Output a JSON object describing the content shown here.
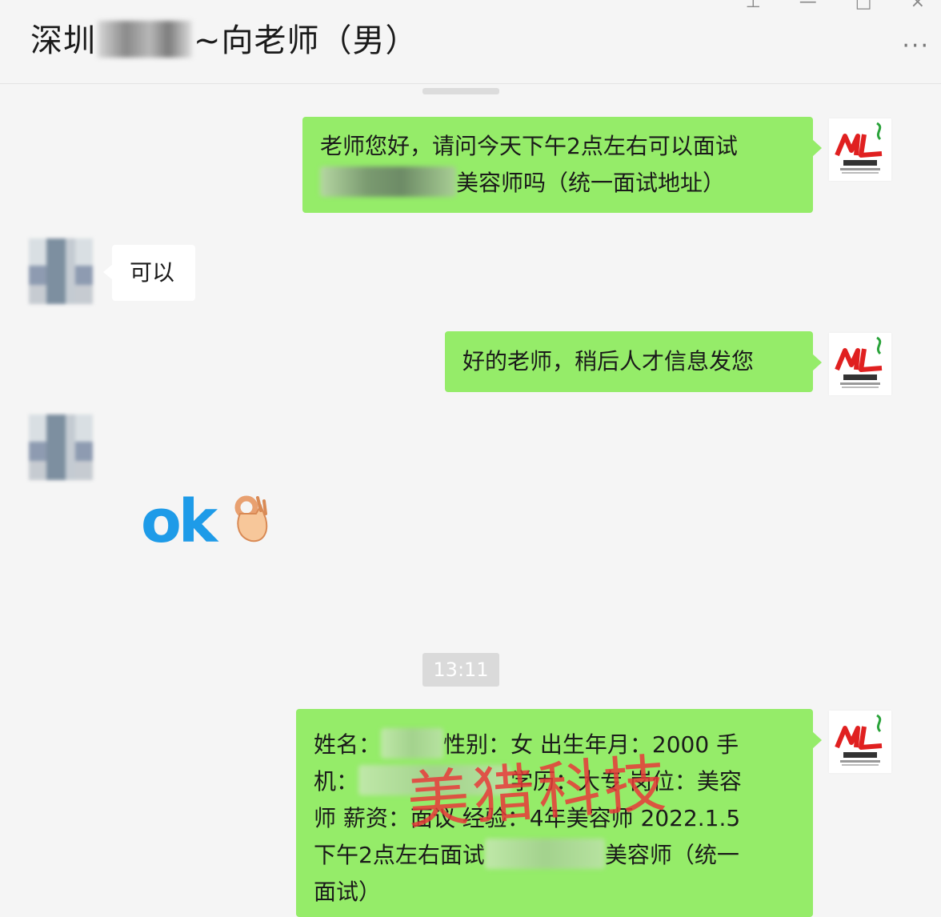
{
  "header": {
    "title_prefix": "深圳",
    "title_suffix": "~向老师（男）",
    "more_label": "···"
  },
  "messages": [
    {
      "from": "me",
      "line1": "老师您好，请问今天下午2点左右可以面试",
      "line2_after_blur": "美容师吗（统一面试地址）"
    },
    {
      "from": "other",
      "text": "可以"
    },
    {
      "from": "me",
      "text": "好的老师，稍后人才信息发您"
    },
    {
      "from": "other",
      "sticker": "ok",
      "sticker_text": "ok",
      "sticker_icon": "ok-hand-icon"
    },
    {
      "from": "me",
      "p1a": "姓名：",
      "p1b": "性别：女 出生年月：2000 手",
      "p2a": "机：",
      "p2b": "学历：大专 岗位：美容",
      "p3": "师 薪资：面议 经验：4年美容师 2022.1.5",
      "p4a": "下午2点左右面试",
      "p4b": "美容师（统一",
      "p5": "面试）"
    }
  ],
  "timestamp": "13:11",
  "watermark": "美猎科技",
  "colors": {
    "my_bubble": "#95ec69",
    "other_bubble": "#ffffff",
    "background": "#f5f5f5",
    "ok_blue": "#1e9be8",
    "logo_red": "#e02020",
    "logo_green": "#2aa33a"
  }
}
